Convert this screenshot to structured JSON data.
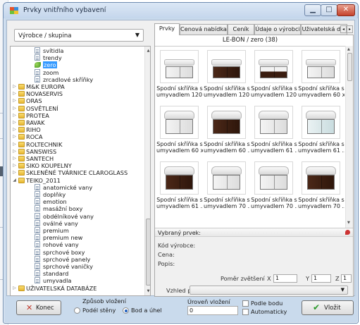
{
  "window": {
    "title": "Prvky vnitřního vybavení"
  },
  "filter": {
    "selected": "Výrobce / skupina"
  },
  "tree": {
    "items": [
      {
        "label": "svítidla",
        "type": "doc",
        "level": 2
      },
      {
        "label": "trendy",
        "type": "doc",
        "level": 2
      },
      {
        "label": "zero",
        "type": "leaf",
        "level": 2,
        "selected": true
      },
      {
        "label": "zoom",
        "type": "doc",
        "level": 2
      },
      {
        "label": "zrcadlové skříňky",
        "type": "doc",
        "level": 2
      },
      {
        "label": "M&K EUROPA",
        "type": "folder",
        "level": 1
      },
      {
        "label": "NOVASERVIS",
        "type": "folder",
        "level": 1
      },
      {
        "label": "ORAS",
        "type": "folder",
        "level": 1
      },
      {
        "label": "OSVĚTLENÍ",
        "type": "folder",
        "level": 1
      },
      {
        "label": "PROTEA",
        "type": "folder",
        "level": 1
      },
      {
        "label": "RAVAK",
        "type": "folder",
        "level": 1
      },
      {
        "label": "RIHO",
        "type": "folder",
        "level": 1
      },
      {
        "label": "ROCA",
        "type": "folder",
        "level": 1
      },
      {
        "label": "ROLTECHNIK",
        "type": "folder",
        "level": 1
      },
      {
        "label": "SANSWISS",
        "type": "folder",
        "level": 1
      },
      {
        "label": "SANTECH",
        "type": "folder",
        "level": 1
      },
      {
        "label": "SIKO KOUPELNY",
        "type": "folder",
        "level": 1
      },
      {
        "label": "SKLENĚNÉ TVÁRNICE CLAROGLASS",
        "type": "folder",
        "level": 1
      },
      {
        "label": "TEIKO_2011",
        "type": "folder",
        "level": 1,
        "expanded": true
      },
      {
        "label": "anatomické vany",
        "type": "doc",
        "level": 2
      },
      {
        "label": "doplňky",
        "type": "doc",
        "level": 2
      },
      {
        "label": "emotion",
        "type": "doc",
        "level": 2
      },
      {
        "label": "masážní boxy",
        "type": "doc",
        "level": 2
      },
      {
        "label": "obdélníkové vany",
        "type": "doc",
        "level": 2
      },
      {
        "label": "oválné vany",
        "type": "doc",
        "level": 2
      },
      {
        "label": "premium",
        "type": "doc",
        "level": 2
      },
      {
        "label": "premium new",
        "type": "doc",
        "level": 2
      },
      {
        "label": "rohové vany",
        "type": "doc",
        "level": 2
      },
      {
        "label": "sprchové boxy",
        "type": "doc",
        "level": 2
      },
      {
        "label": "sprchové panely",
        "type": "doc",
        "level": 2
      },
      {
        "label": "sprchové vaničky",
        "type": "doc",
        "level": 2
      },
      {
        "label": "standard",
        "type": "doc",
        "level": 2
      },
      {
        "label": "umyvadla",
        "type": "doc",
        "level": 2
      },
      {
        "label": "UŽIVATELSKÁ DATABÁZE",
        "type": "folder",
        "level": 1
      }
    ]
  },
  "tabs": [
    "Prvky",
    "Cenová nabídka",
    "Ceník",
    "Údaje o výrobci",
    "Uživatelská dat"
  ],
  "set_title": "LE-BON / zero (38)",
  "products": [
    {
      "line1": "Spodní skříňka s",
      "line2": "umyvadlem 120 ...",
      "style": "white"
    },
    {
      "line1": "Spodní skříňka s",
      "line2": "umyvadlem 120 ...",
      "style": "dark"
    },
    {
      "line1": "Spodní skříňka s",
      "line2": "umyvadlem 120...",
      "style": "mixed"
    },
    {
      "line1": "Spodní skříňka s",
      "line2": "umyvadlem 60 x ...",
      "style": "white"
    },
    {
      "line1": "Spodní skříňka s",
      "line2": "umyvadlem 60 x ...",
      "style": "white"
    },
    {
      "line1": "Spodní skříňka s",
      "line2": "umyvadlem 60 ...",
      "style": "dark"
    },
    {
      "line1": "Spodní skříňka s",
      "line2": "umyvadlem 61 ...",
      "style": "white"
    },
    {
      "line1": "Spodní skříňka s",
      "line2": "umyvadlem 61 ...",
      "style": "glass"
    },
    {
      "line1": "Spodní skříňka s",
      "line2": "umyvadlem 61 ...",
      "style": "dark"
    },
    {
      "line1": "Spodní skříňka s",
      "line2": "umyvadlem 70 ...",
      "style": "white"
    },
    {
      "line1": "Spodní skříňka s",
      "line2": "umyvadlem 70 ...",
      "style": "white"
    },
    {
      "line1": "Spodní skříňka s",
      "line2": "umyvadlem 70 ...",
      "style": "dark"
    }
  ],
  "selected_pane": {
    "header": "Vybraný prvek:",
    "code_label": "Kód výrobce:",
    "price_label": "Cena:",
    "desc_label": "Popis:",
    "ratio_label": "Poměr zvětšení",
    "x_label": "X",
    "x_value": "1",
    "y_label": "Y",
    "y_value": "1",
    "z_label": "Z",
    "z_value": "1",
    "view_label": "Vzhled prvku",
    "view_value": ""
  },
  "bottom": {
    "cancel_label": "Konec",
    "insert_mode_label": "Způsob vložení",
    "radio_wall": "Podél stěny",
    "radio_point": "Bod a úhel",
    "insert_mode_selected": "Bod a úhel",
    "level_label": "Úroveň vložení",
    "level_value": "0",
    "check_floor": "Podle bodu",
    "check_auto": "Automaticky",
    "insert_label": "Vložit"
  }
}
